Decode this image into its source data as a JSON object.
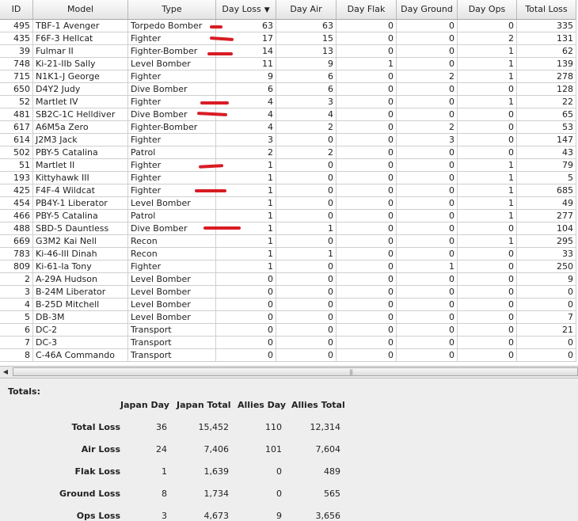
{
  "columns": [
    "ID",
    "Model",
    "Type",
    "Day Loss",
    "Day Air",
    "Day Flak",
    "Day Ground",
    "Day Ops",
    "Total Loss"
  ],
  "sort_indicator": "▼",
  "rows": [
    [
      "495",
      "TBF-1 Avenger",
      "Torpedo Bomber",
      "63",
      "63",
      "0",
      "0",
      "0",
      "335"
    ],
    [
      "435",
      "F6F-3 Hellcat",
      "Fighter",
      "17",
      "15",
      "0",
      "0",
      "2",
      "131"
    ],
    [
      "39",
      "Fulmar II",
      "Fighter-Bomber",
      "14",
      "13",
      "0",
      "0",
      "1",
      "62"
    ],
    [
      "748",
      "Ki-21-IIb Sally",
      "Level Bomber",
      "11",
      "9",
      "1",
      "0",
      "1",
      "139"
    ],
    [
      "715",
      "N1K1-J George",
      "Fighter",
      "9",
      "6",
      "0",
      "2",
      "1",
      "278"
    ],
    [
      "650",
      "D4Y2 Judy",
      "Dive Bomber",
      "6",
      "6",
      "0",
      "0",
      "0",
      "128"
    ],
    [
      "52",
      "Martlet IV",
      "Fighter",
      "4",
      "3",
      "0",
      "0",
      "1",
      "22"
    ],
    [
      "481",
      "SB2C-1C Helldiver",
      "Dive Bomber",
      "4",
      "4",
      "0",
      "0",
      "0",
      "65"
    ],
    [
      "617",
      "A6M5a Zero",
      "Fighter-Bomber",
      "4",
      "2",
      "0",
      "2",
      "0",
      "53"
    ],
    [
      "614",
      "J2M3 Jack",
      "Fighter",
      "3",
      "0",
      "0",
      "3",
      "0",
      "147"
    ],
    [
      "502",
      "PBY-5 Catalina",
      "Patrol",
      "2",
      "2",
      "0",
      "0",
      "0",
      "43"
    ],
    [
      "51",
      "Martlet II",
      "Fighter",
      "1",
      "0",
      "0",
      "0",
      "1",
      "79"
    ],
    [
      "193",
      "Kittyhawk III",
      "Fighter",
      "1",
      "0",
      "0",
      "0",
      "1",
      "5"
    ],
    [
      "425",
      "F4F-4 Wildcat",
      "Fighter",
      "1",
      "0",
      "0",
      "0",
      "1",
      "685"
    ],
    [
      "454",
      "PB4Y-1 Liberator",
      "Level Bomber",
      "1",
      "0",
      "0",
      "0",
      "1",
      "49"
    ],
    [
      "466",
      "PBY-5 Catalina",
      "Patrol",
      "1",
      "0",
      "0",
      "0",
      "1",
      "277"
    ],
    [
      "488",
      "SBD-5 Dauntless",
      "Dive Bomber",
      "1",
      "1",
      "0",
      "0",
      "0",
      "104"
    ],
    [
      "669",
      "G3M2 Kai Nell",
      "Recon",
      "1",
      "0",
      "0",
      "0",
      "1",
      "295"
    ],
    [
      "783",
      "Ki-46-III Dinah",
      "Recon",
      "1",
      "1",
      "0",
      "0",
      "0",
      "33"
    ],
    [
      "809",
      "Ki-61-Ia Tony",
      "Fighter",
      "1",
      "0",
      "0",
      "1",
      "0",
      "250"
    ],
    [
      "2",
      "A-29A Hudson",
      "Level Bomber",
      "0",
      "0",
      "0",
      "0",
      "0",
      "9"
    ],
    [
      "3",
      "B-24M Liberator",
      "Level Bomber",
      "0",
      "0",
      "0",
      "0",
      "0",
      "0"
    ],
    [
      "4",
      "B-25D Mitchell",
      "Level Bomber",
      "0",
      "0",
      "0",
      "0",
      "0",
      "0"
    ],
    [
      "5",
      "DB-3M",
      "Level Bomber",
      "0",
      "0",
      "0",
      "0",
      "0",
      "7"
    ],
    [
      "6",
      "DC-2",
      "Transport",
      "0",
      "0",
      "0",
      "0",
      "0",
      "21"
    ],
    [
      "7",
      "DC-3",
      "Transport",
      "0",
      "0",
      "0",
      "0",
      "0",
      "0"
    ],
    [
      "8",
      "C-46A Commando",
      "Transport",
      "0",
      "0",
      "0",
      "0",
      "0",
      "0"
    ]
  ],
  "scroll_grip": "|||",
  "totals": {
    "title": "Totals:",
    "headers": [
      "Japan Day",
      "Japan Total",
      "Allies Day",
      "Allies Total"
    ],
    "rows": [
      {
        "label": "Total Loss",
        "values": [
          "36",
          "15,452",
          "110",
          "12,314"
        ]
      },
      {
        "label": "Air Loss",
        "values": [
          "24",
          "7,406",
          "101",
          "7,604"
        ]
      },
      {
        "label": "Flak Loss",
        "values": [
          "1",
          "1,639",
          "0",
          "489"
        ]
      },
      {
        "label": "Ground Loss",
        "values": [
          "8",
          "1,734",
          "0",
          "565"
        ]
      },
      {
        "label": "Ops Loss",
        "values": [
          "3",
          "4,673",
          "9",
          "3,656"
        ]
      }
    ]
  },
  "colors": {
    "annotation": "#d81c24",
    "header_bg": "#e4e4e4",
    "grid": "#cfcfcf"
  }
}
